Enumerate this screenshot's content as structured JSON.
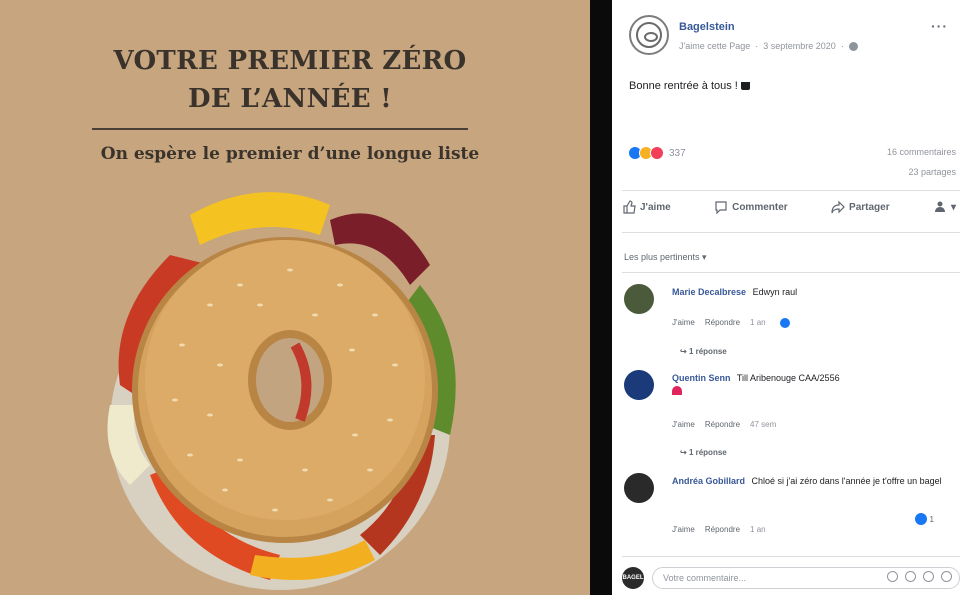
{
  "photo": {
    "title_line1": "VOTRE PREMIER ZÉRO",
    "title_line2": "DE L’ANNÉE !",
    "subtitle": "On espère le premier d’une longue liste",
    "background": "#c6a57f"
  },
  "post": {
    "page_name": "Bagelstein",
    "meta_like": "J'aime cette Page",
    "meta_date": "3 septembre 2020",
    "text": "Bonne rentrée à tous !",
    "reactions_count": "337",
    "comments_count": "16 commentaires",
    "shares_count": "23 partages",
    "actions": {
      "like": "J'aime",
      "comment": "Commenter",
      "share": "Partager"
    },
    "sort_label": "Les plus pertinents ▾",
    "comments": [
      {
        "author": "Marie Decalbrese",
        "text": "Edwyn raul",
        "like": "J'aime",
        "reply": "Répondre",
        "time": "1 an",
        "replies": "1 réponse"
      },
      {
        "author": "Quentin Senn",
        "text": "Till Aribenouge CAA/2556",
        "like": "J'aime",
        "reply": "Répondre",
        "time": "47 sem",
        "replies": "1 réponse"
      },
      {
        "author": "Andréa Gobillard",
        "text": "Chloé si j'ai zéro dans l'année je t'offre un bagel",
        "like": "J'aime",
        "reply": "Répondre",
        "time": "1 an",
        "likes": "1"
      }
    ],
    "composer_placeholder": "Votre commentaire...",
    "composer_avatar": "BAGEL"
  }
}
